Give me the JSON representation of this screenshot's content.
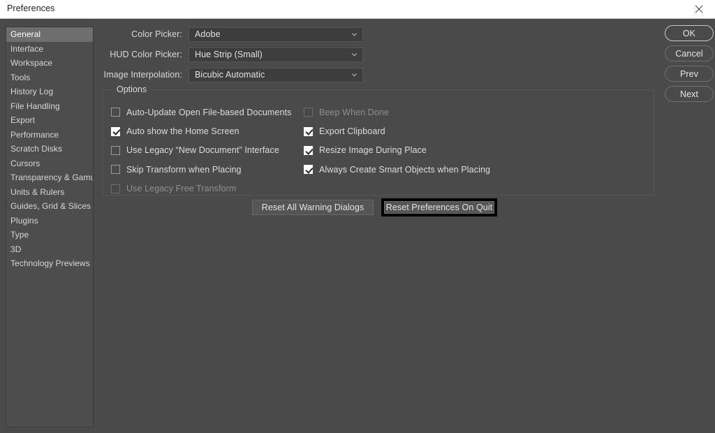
{
  "window": {
    "title": "Preferences",
    "close_icon": "close-icon"
  },
  "sidebar": {
    "items": [
      {
        "label": "General",
        "selected": true
      },
      {
        "label": "Interface",
        "selected": false
      },
      {
        "label": "Workspace",
        "selected": false
      },
      {
        "label": "Tools",
        "selected": false
      },
      {
        "label": "History Log",
        "selected": false
      },
      {
        "label": "File Handling",
        "selected": false
      },
      {
        "label": "Export",
        "selected": false
      },
      {
        "label": "Performance",
        "selected": false
      },
      {
        "label": "Scratch Disks",
        "selected": false
      },
      {
        "label": "Cursors",
        "selected": false
      },
      {
        "label": "Transparency & Gamut",
        "selected": false
      },
      {
        "label": "Units & Rulers",
        "selected": false
      },
      {
        "label": "Guides, Grid & Slices",
        "selected": false
      },
      {
        "label": "Plugins",
        "selected": false
      },
      {
        "label": "Type",
        "selected": false
      },
      {
        "label": "3D",
        "selected": false
      },
      {
        "label": "Technology Previews",
        "selected": false
      }
    ]
  },
  "fields": [
    {
      "label": "Color Picker:",
      "value": "Adobe",
      "arrow_icon": "chevron-down-icon"
    },
    {
      "label": "HUD Color Picker:",
      "value": "Hue Strip (Small)",
      "arrow_icon": "chevron-down-icon"
    },
    {
      "label": "Image Interpolation:",
      "value": "Bicubic Automatic",
      "arrow_icon": "chevron-down-icon"
    }
  ],
  "options": {
    "legend": "Options",
    "left_column": [
      {
        "label": "Auto-Update Open File-based Documents",
        "checked": false,
        "disabled": false
      },
      {
        "label": "Auto show the Home Screen",
        "checked": true,
        "disabled": false
      },
      {
        "label": "Use Legacy “New Document” Interface",
        "checked": false,
        "disabled": false
      },
      {
        "label": "Skip Transform when Placing",
        "checked": false,
        "disabled": false
      },
      {
        "label": "Use Legacy Free Transform",
        "checked": false,
        "disabled": true
      }
    ],
    "right_column": [
      {
        "label": "Beep When Done",
        "checked": false,
        "disabled": true
      },
      {
        "label": "Export Clipboard",
        "checked": true,
        "disabled": false
      },
      {
        "label": "Resize Image During Place",
        "checked": true,
        "disabled": false
      },
      {
        "label": "Always Create Smart Objects when Placing",
        "checked": true,
        "disabled": false
      }
    ]
  },
  "reset_buttons": {
    "reset_warnings": "Reset All Warning Dialogs",
    "reset_on_quit": "Reset Preferences On Quit"
  },
  "side_buttons": [
    {
      "label": "OK",
      "primary": true
    },
    {
      "label": "Cancel",
      "primary": false
    },
    {
      "label": "Prev",
      "primary": false
    },
    {
      "label": "Next",
      "primary": false
    }
  ],
  "colors": {
    "titlebar_bg": "#ffffff",
    "dialog_bg": "#4a4a4a",
    "sidebar_bg": "#4d4d4d",
    "selection_bg": "#6e6e6e",
    "field_bg": "#3d3d3d",
    "text": "#dedede",
    "focus_ring": "#000000"
  }
}
